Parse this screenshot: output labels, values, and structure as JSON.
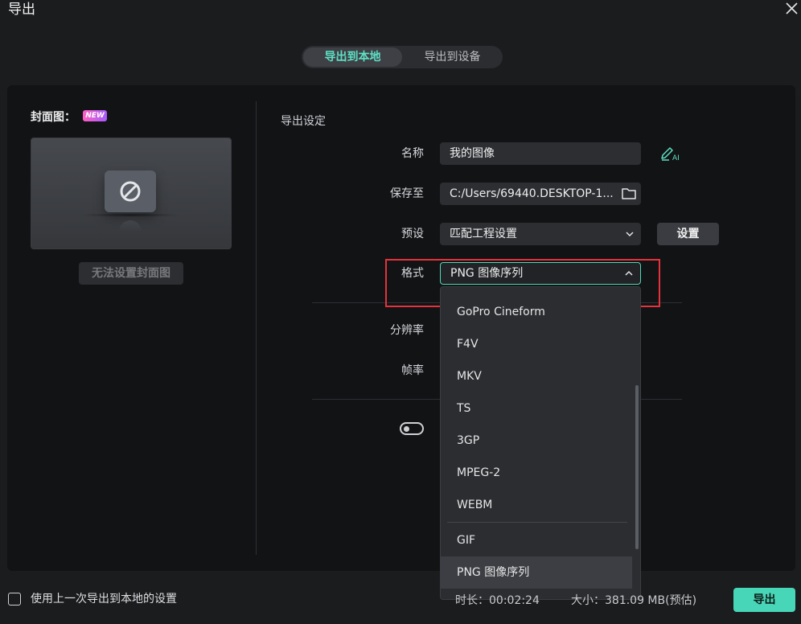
{
  "window": {
    "title": "导出"
  },
  "tabs": [
    {
      "label": "导出到本地",
      "active": true
    },
    {
      "label": "导出到设备",
      "active": false
    }
  ],
  "cover": {
    "label": "封面图：",
    "new_badge": "NEW",
    "button_label": "无法设置封面图"
  },
  "export_settings": {
    "section_title": "导出设定",
    "name": {
      "label": "名称",
      "value": "我的图像"
    },
    "save_to": {
      "label": "保存至",
      "value": "C:/Users/69440.DESKTOP-1..."
    },
    "preset": {
      "label": "预设",
      "value": "匹配工程设置",
      "settings_button": "设置"
    },
    "format": {
      "label": "格式",
      "value": "PNG 图像序列"
    },
    "resolution": {
      "label": "分辨率"
    },
    "frame_rate": {
      "label": "帧率"
    }
  },
  "format_dropdown": {
    "items": [
      "GoPro Cineform",
      "F4V",
      "MKV",
      "TS",
      "3GP",
      "MPEG-2",
      "WEBM",
      "GIF",
      "PNG 图像序列"
    ],
    "selected": "PNG 图像序列"
  },
  "bottom": {
    "checkbox_label": "使用上一次导出到本地的设置",
    "duration": "时长：00:02:24",
    "size": "大小：381.09 MB(预估)",
    "export_button": "导出"
  },
  "colors": {
    "accent": "#47d7b8",
    "highlight_box": "#e5323c",
    "background": "#1b1c1e"
  }
}
